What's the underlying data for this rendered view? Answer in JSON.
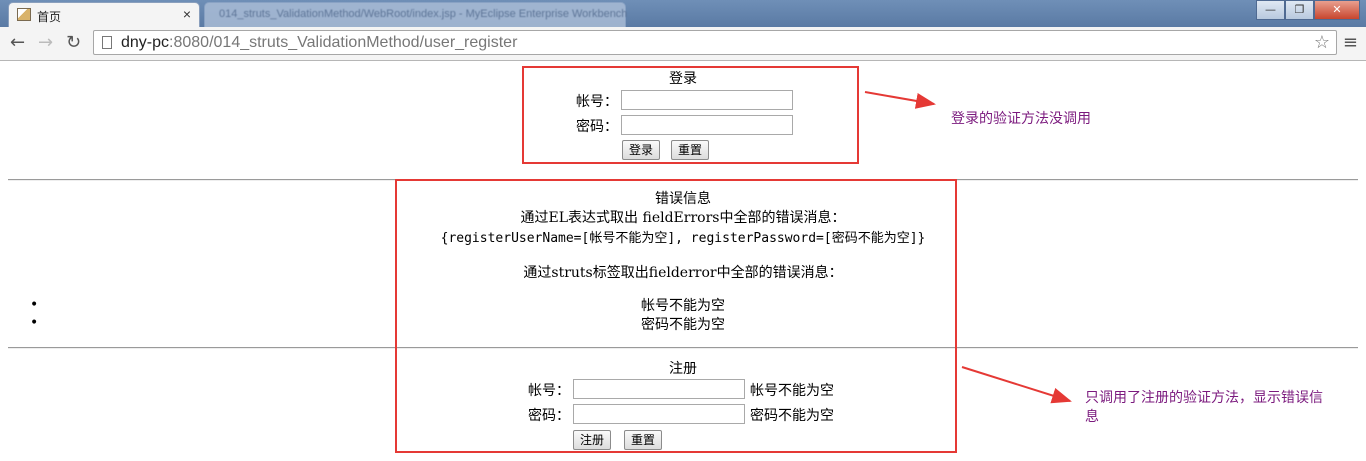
{
  "browser": {
    "active_tab": {
      "title": "首页",
      "close": "×"
    },
    "inactive_tab": {
      "title": "014_struts_ValidationMethod/WebRoot/index.jsp - MyEclipse Enterprise Workbench"
    },
    "window_buttons": {
      "minimize": "—",
      "maximize": "❐",
      "close": "✕"
    },
    "nav": {
      "back": "←",
      "forward": "→",
      "reload": "↻"
    },
    "url": {
      "host": "dny-pc",
      "rest": ":8080/014_struts_ValidationMethod/user_register"
    },
    "star": "☆",
    "menu": "≡"
  },
  "login_form": {
    "title": "登录",
    "username_label": "帐号：",
    "password_label": "密码：",
    "submit": "登录",
    "reset": "重置"
  },
  "errors": {
    "title": "错误信息",
    "el_heading": "通过EL表达式取出 fieldErrors中全部的错误消息：",
    "el_value": "{registerUserName=[帐号不能为空], registerPassword=[密码不能为空]}",
    "struts_heading": "通过struts标签取出fielderror中全部的错误消息：",
    "items": [
      "帐号不能为空",
      "密码不能为空"
    ]
  },
  "register_form": {
    "title": "注册",
    "username_label": "帐号：",
    "username_error": "帐号不能为空",
    "password_label": "密码：",
    "password_error": "密码不能为空",
    "submit": "注册",
    "reset": "重置"
  },
  "annotations": {
    "login_note": "登录的验证方法没调用",
    "register_note_line1": "只调用了注册的验证方法，显示错误信",
    "register_note_line2": "息"
  },
  "colors": {
    "annotation_box": "#e53935",
    "annotation_text": "#7b1a7e"
  }
}
